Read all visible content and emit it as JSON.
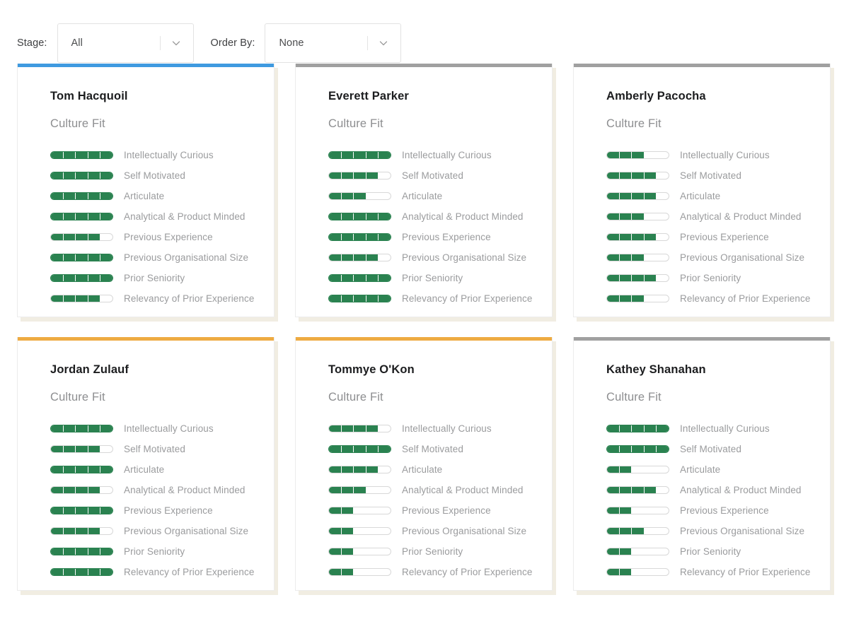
{
  "filters": [
    {
      "label": "Stage:",
      "value": "All",
      "name": "stage"
    },
    {
      "label": "Order By:",
      "value": "None",
      "name": "order-by"
    }
  ],
  "attributes": [
    "Intellectually Curious",
    "Self Motivated",
    "Articulate",
    "Analytical & Product Minded",
    "Previous Experience",
    "Previous Organisational Size",
    "Prior Seniority",
    "Relevancy of Prior Experience"
  ],
  "section_title": "Culture Fit",
  "scale_max": 5,
  "colors": {
    "accent_blue": "#3f9ae0",
    "accent_gray": "#a0a0a0",
    "accent_orange": "#eeab42",
    "bar_green": "#2a8250",
    "bar_empty": "#ffffff",
    "bar_border": "#d8d8d8",
    "card_shadow": "#f1ede2"
  },
  "cards": [
    {
      "name": "Tom Hacquoil",
      "accent": "#3f9ae0",
      "ratings": [
        5,
        5,
        5,
        5,
        4,
        5,
        5,
        4
      ]
    },
    {
      "name": "Everett Parker",
      "accent": "#a0a0a0",
      "ratings": [
        5,
        4,
        3,
        5,
        5,
        4,
        5,
        5
      ]
    },
    {
      "name": "Amberly Pacocha",
      "accent": "#a0a0a0",
      "ratings": [
        3,
        4,
        4,
        3,
        4,
        3,
        4,
        3
      ]
    },
    {
      "name": "Jordan Zulauf",
      "accent": "#eeab42",
      "ratings": [
        5,
        4,
        5,
        4,
        5,
        4,
        5,
        5
      ]
    },
    {
      "name": "Tommye O'Kon",
      "accent": "#eeab42",
      "ratings": [
        4,
        5,
        4,
        3,
        2,
        2,
        2,
        2
      ]
    },
    {
      "name": "Kathey Shanahan",
      "accent": "#a0a0a0",
      "ratings": [
        5,
        5,
        2,
        4,
        2,
        3,
        2,
        2
      ]
    }
  ]
}
